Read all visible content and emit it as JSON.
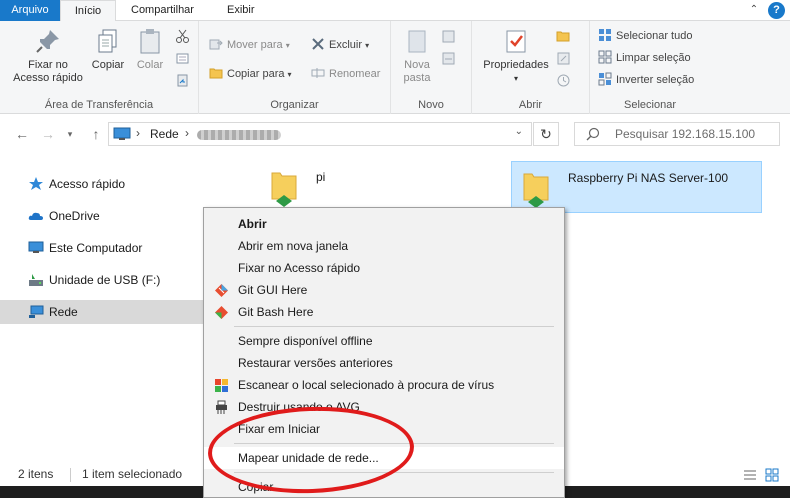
{
  "tabs": {
    "file": "Arquivo",
    "home": "Início",
    "share": "Compartilhar",
    "view": "Exibir",
    "help": "?"
  },
  "ribbon": {
    "clipboard": {
      "label": "Área de Transferência",
      "pin": "Fixar no Acesso rápido",
      "pin_line1": "Fixar no",
      "pin_line2": "Acesso rápido",
      "copy": "Copiar",
      "paste": "Colar"
    },
    "organize": {
      "label": "Organizar",
      "move_to": "Mover para",
      "copy_to": "Copiar para",
      "delete": "Excluir",
      "rename": "Renomear"
    },
    "new": {
      "label": "Novo",
      "new_folder_line1": "Nova",
      "new_folder_line2": "pasta"
    },
    "open": {
      "label": "Abrir",
      "properties": "Propriedades"
    },
    "select": {
      "label": "Selecionar",
      "select_all": "Selecionar tudo",
      "clear_selection": "Limpar seleção",
      "invert_selection": "Inverter seleção"
    }
  },
  "address": {
    "root": "Rede",
    "search_placeholder": "Pesquisar 192.168.15.100"
  },
  "sidebar": {
    "items": [
      {
        "label": "Acesso rápido",
        "icon": "star-icon"
      },
      {
        "label": "OneDrive",
        "icon": "cloud-icon"
      },
      {
        "label": "Este Computador",
        "icon": "computer-icon"
      },
      {
        "label": "Unidade de USB (F:)",
        "icon": "usb-drive-icon"
      },
      {
        "label": "Rede",
        "icon": "network-icon"
      }
    ]
  },
  "files": [
    {
      "name": "pi"
    },
    {
      "name": "Raspberry Pi NAS Server-100"
    }
  ],
  "status": {
    "count": "2 itens",
    "selected": "1 item selecionado"
  },
  "context_menu": {
    "items": [
      "Abrir",
      "Abrir em nova janela",
      "Fixar no Acesso rápido",
      "Git GUI Here",
      "Git Bash Here",
      "Sempre disponível offline",
      "Restaurar versões anteriores",
      "Escanear o local selecionado à procura de vírus",
      "Destruir usando o AVG",
      "Fixar em Iniciar",
      "Mapear unidade de rede...",
      "Copiar"
    ]
  },
  "colors": {
    "accent": "#1979ca",
    "selection": "#cce8ff",
    "highlight_oval": "#e01b1b"
  }
}
